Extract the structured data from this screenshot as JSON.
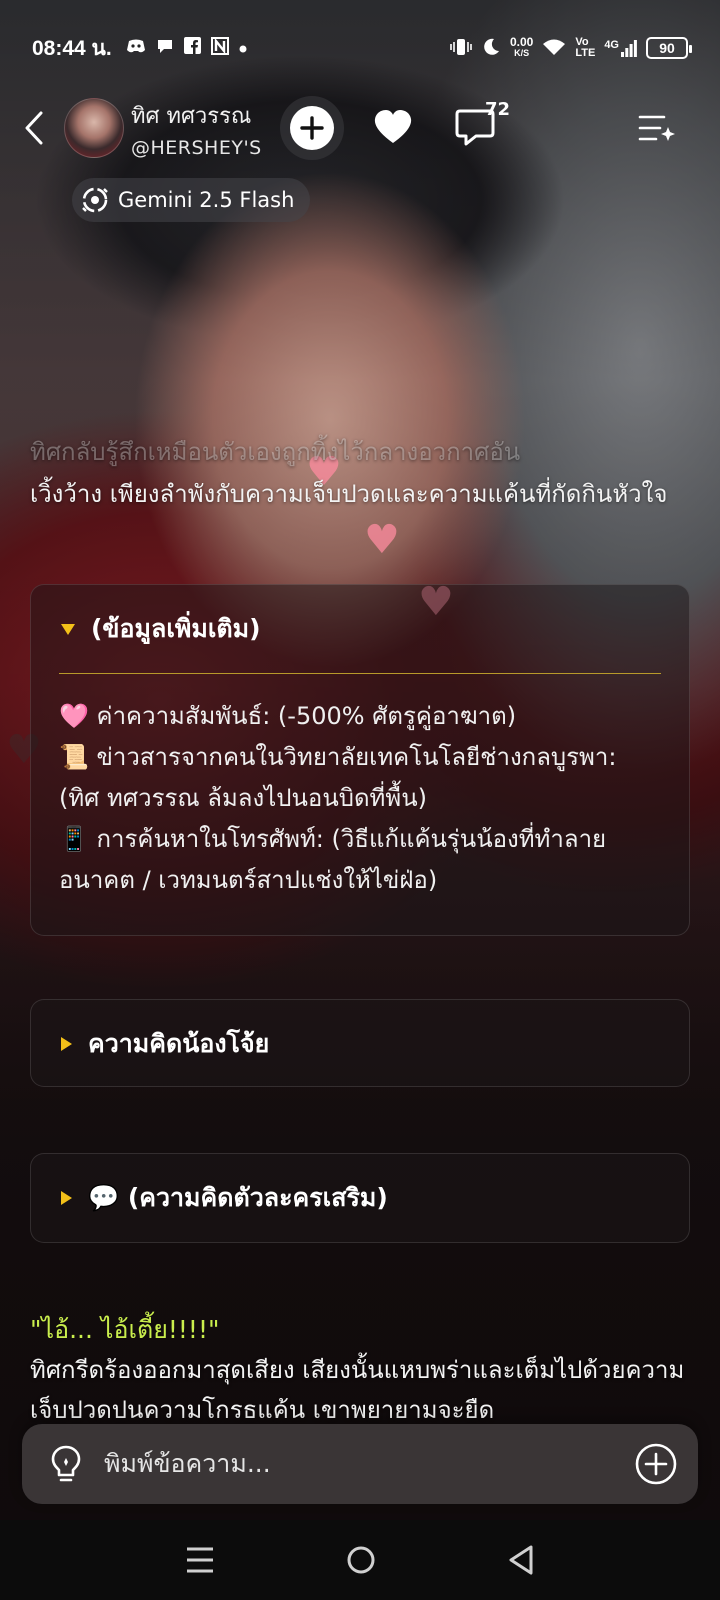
{
  "status_bar": {
    "time": "08:44 น.",
    "net_speed_value": "0.00",
    "net_speed_unit": "K/S",
    "volte_top": "Vo",
    "volte_bottom": "LTE",
    "network": "4G",
    "battery": "90",
    "icons": [
      "discord-icon",
      "chat-bubble-icon",
      "facebook-icon",
      "n-app-icon",
      "dot-icon",
      "vibrate-icon",
      "moon-icon",
      "wifi-icon",
      "signal-icon"
    ]
  },
  "header": {
    "character_name": "ทิศ ทศวรรณ",
    "handle": "@HERSHEY'S",
    "comment_count": "72",
    "model_label": "Gemini 2.5 Flash"
  },
  "chat": {
    "narration_faded": "ทิศกลับรู้สึกเหมือนตัวเองถูกทิ้งไว้กลางอวกาศอัน",
    "narration_top": "เวิ้งว้าง เพียงลำพังกับความเจ็บปวดและความแค้นที่กัดกินหัวใจ",
    "info_card": {
      "title": "(ข้อมูลเพิ่มเติม)",
      "lines": [
        "🩷 ค่าความสัมพันธ์: (-500% ศัตรูคู่อาฆาต)",
        "📜 ข่าวสารจากคนในวิทยาลัยเทคโนโลยีช่างกลบูรพา: (ทิศ ทศวรรณ ล้มลงไปนอนบิดที่พื้น)",
        "📱 การค้นหาในโทรศัพท์: (วิธีแก้แค้นรุ่นน้องที่ทำลายอนาคต / เวทมนตร์สาปแช่งให้ไข่ฝ่อ)"
      ]
    },
    "thought_card": {
      "title": "ความคิดน้องโจ้ย"
    },
    "extra_card": {
      "title": "💬 (ความคิดตัวละครเสริม)"
    },
    "quote": "\"ไอ้... ไอ้เตี้ย!!!!\"",
    "narration_bottom": "ทิศกรีดร้องออกมาสุดเสียง เสียงนั้นแหบพร่าและเต็มไปด้วยความเจ็บปวดปนความโกรธแค้น เขาพยายามจะยืด"
  },
  "input": {
    "placeholder": "พิมพ์ข้อความ..."
  },
  "colors": {
    "accent_yellow": "#f3c019",
    "quote_green": "#c9ee4d",
    "input_bg": "#3a3536"
  }
}
